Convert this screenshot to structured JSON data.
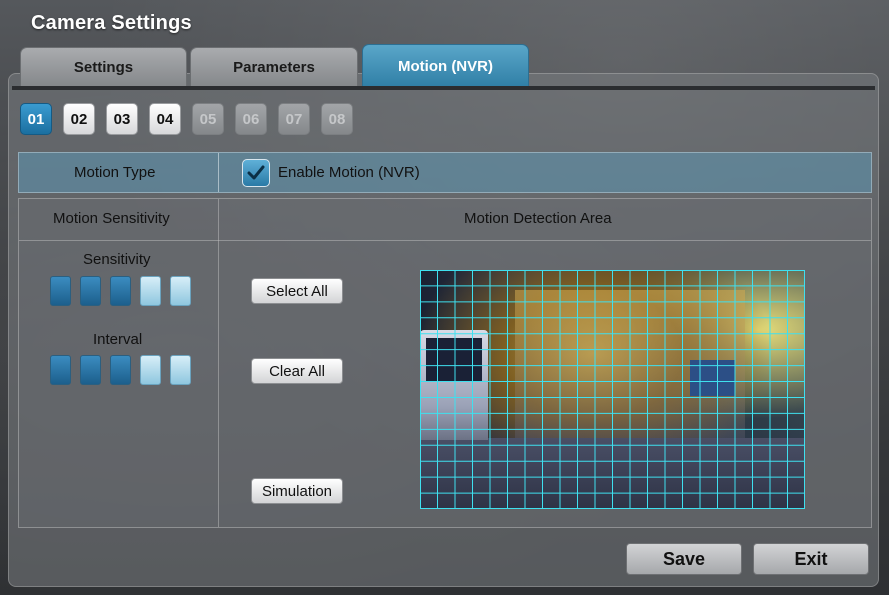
{
  "window": {
    "title": "Camera Settings"
  },
  "tabs": [
    {
      "label": "Settings",
      "active": false
    },
    {
      "label": "Parameters",
      "active": false
    },
    {
      "label": "Motion (NVR)",
      "active": true
    }
  ],
  "channels": [
    {
      "label": "01",
      "state": "active"
    },
    {
      "label": "02",
      "state": "enabled"
    },
    {
      "label": "03",
      "state": "enabled"
    },
    {
      "label": "04",
      "state": "enabled"
    },
    {
      "label": "05",
      "state": "disabled"
    },
    {
      "label": "06",
      "state": "disabled"
    },
    {
      "label": "07",
      "state": "disabled"
    },
    {
      "label": "08",
      "state": "disabled"
    }
  ],
  "motion_type": {
    "label": "Motion Type",
    "enable_label": "Enable Motion (NVR)",
    "enabled": true
  },
  "sections": {
    "sensitivity_header": "Motion Sensitivity",
    "area_header": "Motion Detection Area"
  },
  "sensitivity": {
    "label": "Sensitivity",
    "level": 3,
    "max": 5
  },
  "interval": {
    "label": "Interval",
    "level": 3,
    "max": 5
  },
  "area_buttons": {
    "select_all": "Select All",
    "clear_all": "Clear All",
    "simulation": "Simulation"
  },
  "detection_grid": {
    "columns": 22,
    "rows": 15,
    "line_color": "#3fe0ef"
  },
  "footer": {
    "save": "Save",
    "exit": "Exit"
  },
  "colors": {
    "accent": "#2f7ea5",
    "row_highlight": "#5c96b2"
  }
}
